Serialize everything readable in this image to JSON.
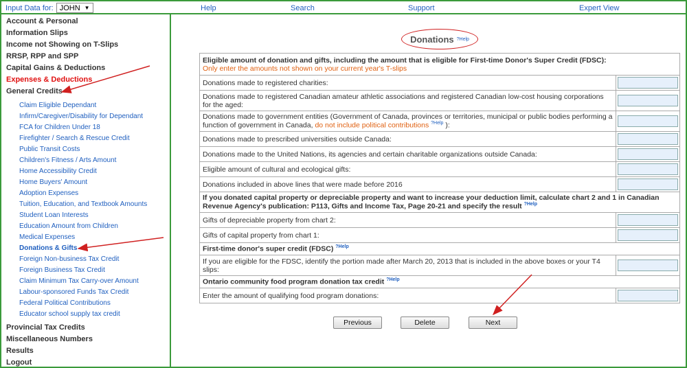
{
  "topbar": {
    "input_label": "Input Data for:",
    "selected_user": "JOHN",
    "links": [
      "Help",
      "Search",
      "Support",
      "Expert View"
    ]
  },
  "sidebar": {
    "top_before": [
      "Account & Personal",
      "Information Slips",
      "Income not Showing on T-Slips",
      "RRSP, RPP and SPP",
      "Capital Gains & Deductions"
    ],
    "active_section": "Expenses & Deductions",
    "general_credits": "General Credits",
    "sub_items": [
      "Claim Eligible Dependant",
      "Infirm/Caregiver/Disability for Dependant",
      "FCA for Children Under 18",
      "Firefighter / Search & Rescue Credit",
      "Public Transit Costs",
      "Children's Fitness / Arts Amount",
      "Home Accessibility Credit",
      "Home Buyers' Amount",
      "Adoption Expenses",
      "Tuition, Education, and Textbook Amounts",
      "Student Loan Interests",
      "Education Amount from Children",
      "Medical Expenses",
      "Donations & Gifts",
      "Foreign Non-business Tax Credit",
      "Foreign Business Tax Credit",
      "Claim Minimum Tax Carry-over Amount",
      "Labour-sponsored Funds Tax Credit",
      "Federal Political Contributions",
      "Educator school supply tax credit"
    ],
    "top_after": [
      "Provincial Tax Credits",
      "Miscellaneous Numbers",
      "Results",
      "Logout"
    ]
  },
  "main": {
    "title": "Donations",
    "help": "?Help",
    "section1_header": "Eligible amount of donation and gifts, including the amount that is eligible for First-time Donor's Super Credit (FDSC):",
    "section1_note": "Only enter the amounts not shown on your current year's T-slips",
    "row_charities": "Donations made to registered charities:",
    "row_athletic": "Donations made to registered Canadian amateur athletic associations and registered Canadian low-cost housing corporations for the aged:",
    "row_gov_a": "Donations made to government entities (Government of Canada, provinces or territories, municipal or public bodies performing a function of government in Canada,",
    "row_gov_b": "do not include political contributions",
    "row_gov_c": "):",
    "row_universities": "Donations made to prescribed universities outside Canada:",
    "row_un": "Donations made to the United Nations, its agencies and certain charitable organizations outside Canada:",
    "row_cultural": "Eligible amount of cultural and ecological gifts:",
    "row_before2016": "Donations included in above lines that were made before 2016",
    "section2_header": "If you donated capital property or depreciable property and want to increase your deduction limit, calculate chart 2 and 1 in Canadian Revenue Agency's publication: P113, Gifts and Income Tax, Page 20-21 and specify the result",
    "row_depreciable": "Gifts of depreciable property from chart 2:",
    "row_capital": "Gifts of capital property from chart 1:",
    "section3_header": "First-time donor's super credit (FDSC)",
    "row_fdsc": "If you are eligible for the FDSC, identify the portion made after March 20, 2013 that is included in the above boxes or your T4 slips:",
    "section4_header": "Ontario community food program donation tax credit",
    "row_food": "Enter the amount of qualifying food program donations:"
  },
  "buttons": {
    "previous": "Previous",
    "delete": "Delete",
    "next": "Next"
  },
  "colors": {
    "border_green": "#3a9a3a",
    "link_blue": "#1f5fbf",
    "accent_red": "#e01010",
    "note_orange": "#e06010",
    "input_bg": "#e6f0fb"
  }
}
